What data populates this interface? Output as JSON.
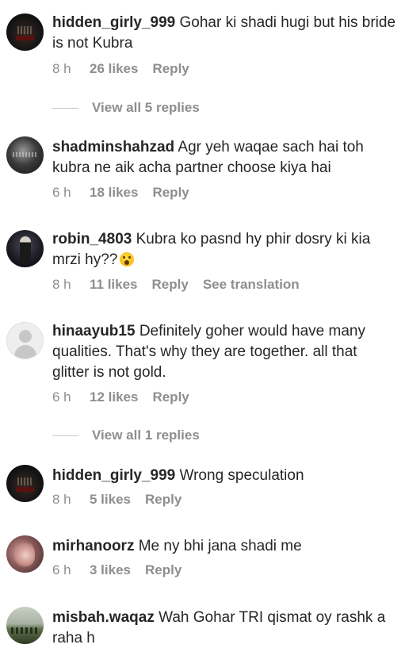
{
  "comments": [
    {
      "username": "hidden_girly_999",
      "text": "Gohar ki shadi hugi but his bride is not Kubra",
      "time": "8 h",
      "likes": "26 likes",
      "reply": "Reply",
      "view_replies": "View all 5 replies",
      "avatar": "dark-room-avatar"
    },
    {
      "username": "shadminshahzad",
      "text": "Agr yeh waqae sach hai toh kubra ne aik acha partner choose kiya hai",
      "time": "6 h",
      "likes": "18 likes",
      "reply": "Reply",
      "avatar": "smoke-text-avatar"
    },
    {
      "username": "robin_4803",
      "text": "Kubra ko pasnd hy phir dosry ki kia mrzi hy??",
      "emoji": "astonished-face-emoji",
      "time": "8 h",
      "likes": "11 likes",
      "reply": "Reply",
      "see_translation": "See translation",
      "avatar": "couple-avatar"
    },
    {
      "username": "hinaayub15",
      "text": "Definitely goher would have many qualities. That's why they are together. all that glitter is not gold.",
      "time": "6 h",
      "likes": "12 likes",
      "reply": "Reply",
      "view_replies": "View all 1 replies",
      "avatar": "default-user-icon"
    },
    {
      "username": "hidden_girly_999",
      "text": "Wrong speculation",
      "time": "8 h",
      "likes": "5 likes",
      "reply": "Reply",
      "avatar": "dark-room-avatar"
    },
    {
      "username": "mirhanoorz",
      "text": "Me ny bhi jana shadi me",
      "time": "6 h",
      "likes": "3 likes",
      "reply": "Reply",
      "avatar": "portrait-avatar"
    },
    {
      "username": "misbah.waqaz",
      "text": "Wah Gohar TRI qismat oy rashk a raha h",
      "avatar": "landscape-avatar"
    }
  ]
}
